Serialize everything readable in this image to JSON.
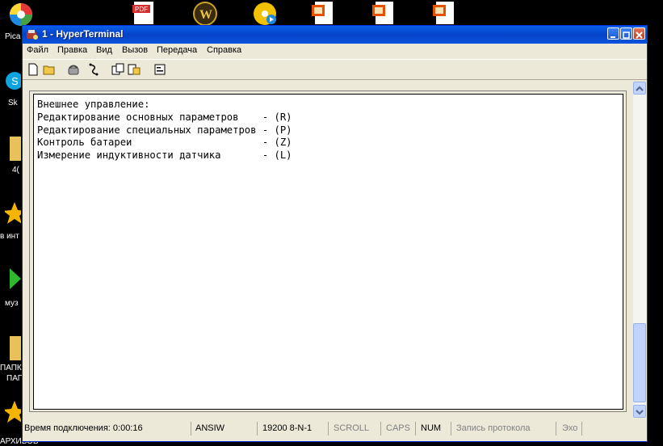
{
  "desktop": {
    "icons": [
      {
        "name": "picasa-icon"
      },
      {
        "name": "pdf-icon",
        "label": "PDF"
      },
      {
        "name": "warcraft-icon",
        "label": "W"
      },
      {
        "name": "media-icon"
      },
      {
        "name": "presentation-icon-1"
      },
      {
        "name": "presentation-icon-2"
      },
      {
        "name": "presentation-icon-3"
      }
    ],
    "left_labels": [
      "Pica",
      "Sk",
      "4(",
      "в инт",
      "муз",
      "ПАПК",
      "ПАП",
      "АРХИВОВ"
    ]
  },
  "window": {
    "title": "1 - HyperTerminal",
    "menu": [
      "Файл",
      "Правка",
      "Вид",
      "Вызов",
      "Передача",
      "Справка"
    ],
    "terminal_lines": [
      "Внешнее управление:",
      "Редактирование основных параметров    - (R)",
      "Редактирование специальных параметров - (P)",
      "Контроль батареи                      - (Z)",
      "Измерение индуктивности датчика       - (L)"
    ],
    "status": {
      "connect_time": "Время подключения: 0:00:16",
      "emulation": "ANSIW",
      "port_settings": "19200 8-N-1",
      "scroll": "SCROLL",
      "caps": "CAPS",
      "num": "NUM",
      "capture": "Запись протокола",
      "echo": "Эхо"
    }
  },
  "colors": {
    "titlebar": "#0542C9",
    "window_bg": "#ECE9D8",
    "terminal_bg": "#FFFFFF"
  }
}
